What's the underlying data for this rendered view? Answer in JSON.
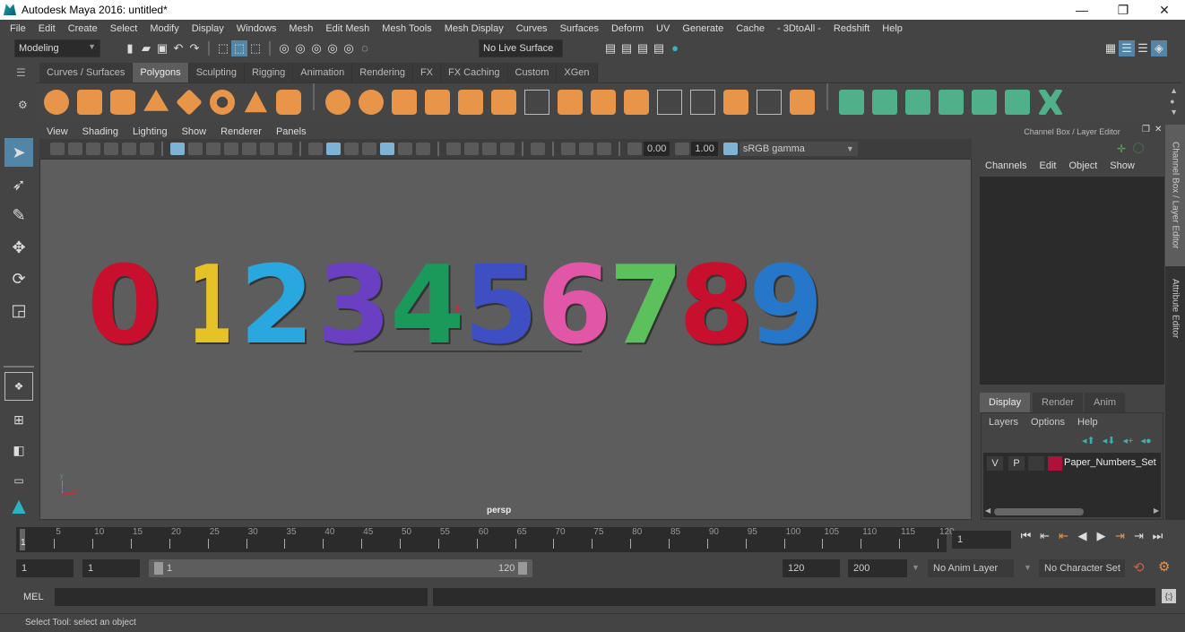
{
  "window": {
    "title": "Autodesk Maya 2016: untitled*",
    "minimize": "—",
    "restore": "❐",
    "close": "✕"
  },
  "menubar": [
    "File",
    "Edit",
    "Create",
    "Select",
    "Modify",
    "Display",
    "Windows",
    "Mesh",
    "Edit Mesh",
    "Mesh Tools",
    "Mesh Display",
    "Curves",
    "Surfaces",
    "Deform",
    "UV",
    "Generate",
    "Cache",
    "- 3DtoAll -",
    "Redshift",
    "Help"
  ],
  "statusline": {
    "menuset": "Modeling",
    "live_surface": "No Live Surface"
  },
  "shelf": {
    "tabs": [
      "Curves / Surfaces",
      "Polygons",
      "Sculpting",
      "Rigging",
      "Animation",
      "Rendering",
      "FX",
      "FX Caching",
      "Custom",
      "XGen"
    ],
    "active_tab": "Polygons",
    "icons": [
      "poly-sphere-icon",
      "poly-cube-icon",
      "poly-cylinder-icon",
      "poly-cone-icon",
      "poly-plane-icon",
      "poly-torus-icon",
      "poly-pyramid-icon",
      "poly-pipe-icon",
      "combine-icon",
      "separate-icon",
      "mirror-icon",
      "smooth-icon",
      "extract-icon",
      "booleans-icon",
      "multi-cut-icon",
      "extrude-icon",
      "bridge-icon",
      "bevel-icon",
      "insert-edge-loop-icon",
      "offset-edge-loop-icon",
      "append-icon",
      "fill-hole-icon",
      "merge-icon",
      "planar-uv-icon",
      "cylindrical-uv-icon",
      "spherical-uv-icon",
      "automatic-uv-icon",
      "unfold-uv-icon",
      "uv-editor-icon",
      "layout-uv-icon"
    ]
  },
  "panel": {
    "menu": [
      "View",
      "Shading",
      "Lighting",
      "Show",
      "Renderer",
      "Panels"
    ],
    "exposure": "0.00",
    "gamma": "1.00",
    "color_space": "sRGB gamma",
    "camera_label": "persp"
  },
  "scene": {
    "digits": [
      {
        "char": "0",
        "color": "#c8102e"
      },
      {
        "char": "1",
        "color": "#e6c229"
      },
      {
        "char": "2",
        "color": "#29a8e0"
      },
      {
        "char": "3",
        "color": "#6a3fc1"
      },
      {
        "char": "4",
        "color": "#1a9a5a"
      },
      {
        "char": "5",
        "color": "#3e4fc4"
      },
      {
        "char": "6",
        "color": "#e256a8"
      },
      {
        "char": "7",
        "color": "#5cc15c"
      },
      {
        "char": "8",
        "color": "#c8102e"
      },
      {
        "char": "9",
        "color": "#2677c9"
      }
    ],
    "axis": {
      "y": "y",
      "z": "z",
      "x": "x"
    }
  },
  "channelbox": {
    "title": "Channel Box / Layer Editor",
    "menu": [
      "Channels",
      "Edit",
      "Object",
      "Show"
    ]
  },
  "layereditor": {
    "tabs": [
      "Display",
      "Render",
      "Anim"
    ],
    "active_tab": "Display",
    "menu": [
      "Layers",
      "Options",
      "Help"
    ],
    "layers": [
      {
        "visible": "V",
        "playback": "P",
        "color": "#b0103a",
        "name": "Paper_Numbers_Set"
      }
    ]
  },
  "side_tabs": [
    "Channel Box / Layer Editor",
    "Attribute Editor"
  ],
  "timeline": {
    "ticks": [
      5,
      10,
      15,
      20,
      25,
      30,
      35,
      40,
      45,
      50,
      55,
      60,
      65,
      70,
      75,
      80,
      85,
      90,
      95,
      100,
      105,
      110,
      115,
      120
    ],
    "start_label": "1",
    "current_frame": "1"
  },
  "range": {
    "start": "1",
    "playback_start": "1",
    "slider_min": "1",
    "slider_max": "120",
    "playback_end": "120",
    "end": "200",
    "anim_layer": "No Anim Layer",
    "character_set": "No Character Set"
  },
  "cmdline": {
    "label": "MEL"
  },
  "helpline": {
    "text": "Select Tool: select an object"
  }
}
